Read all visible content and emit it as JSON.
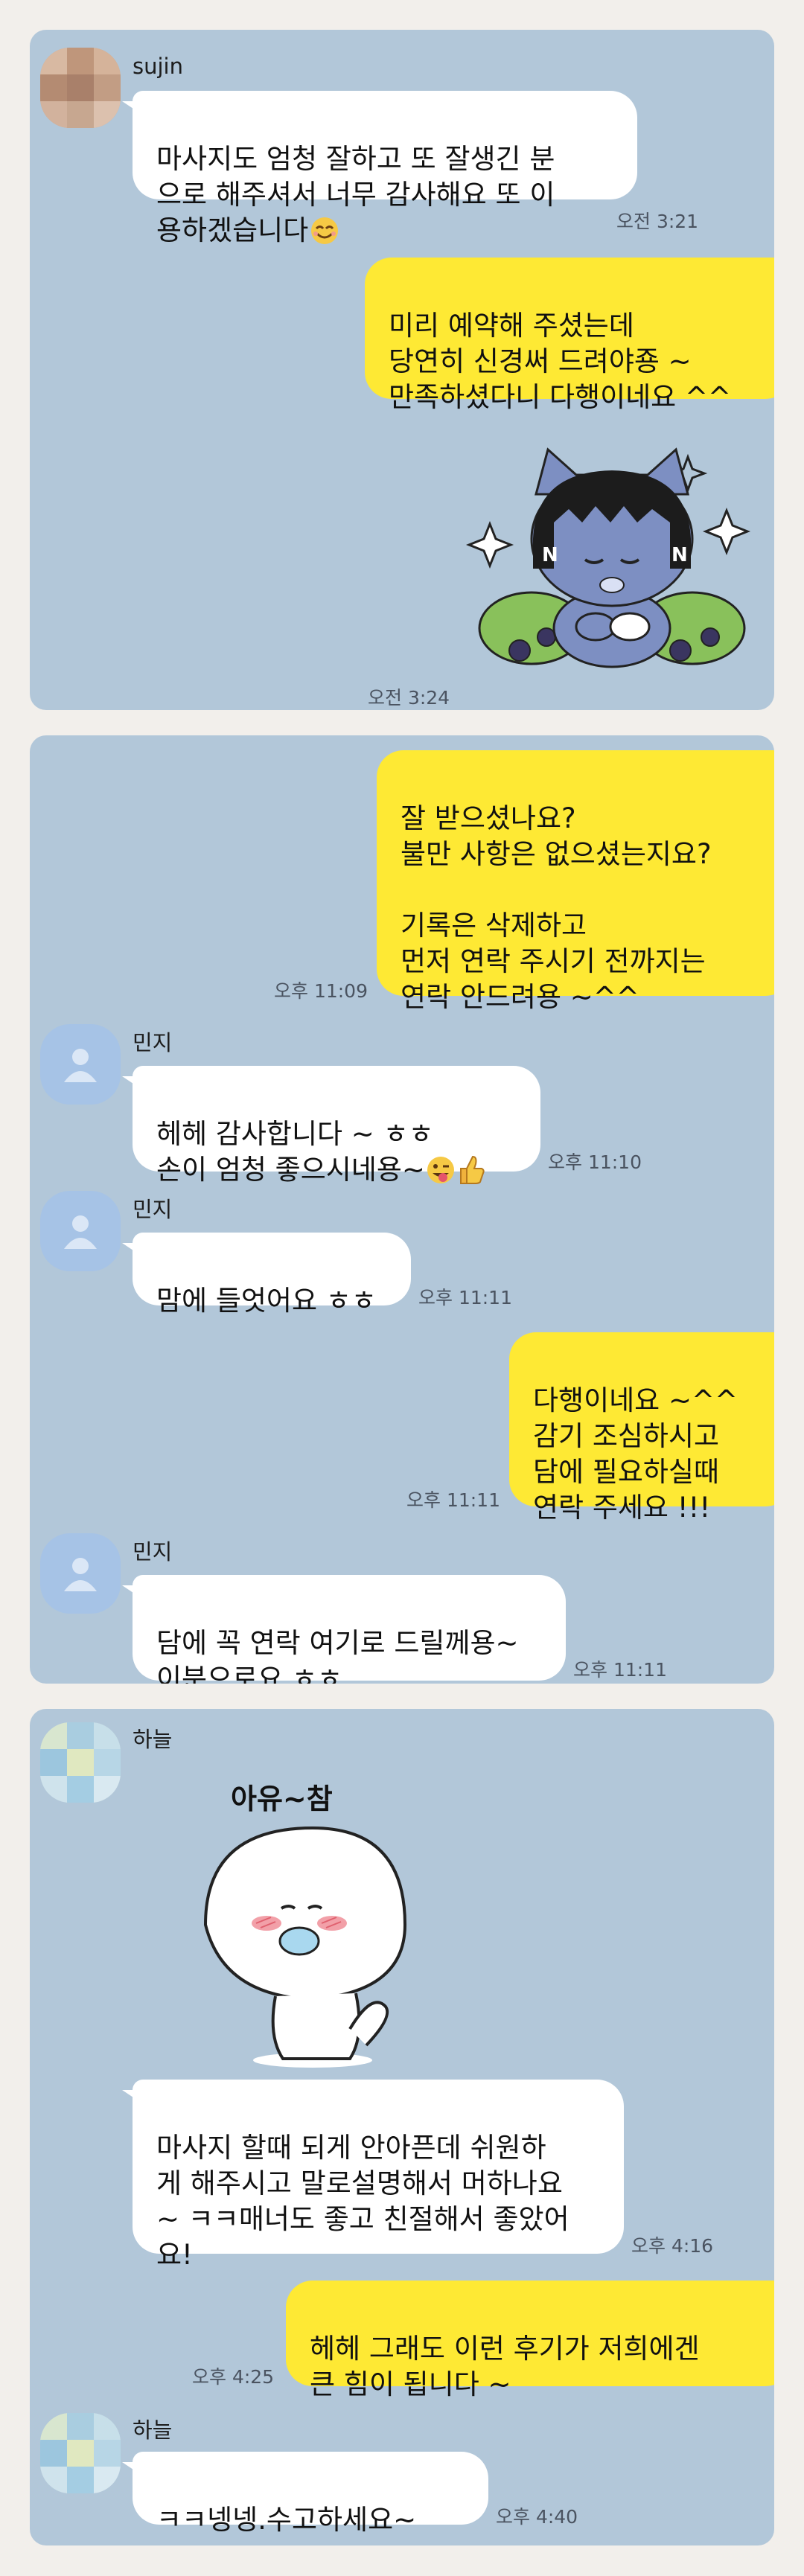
{
  "panel1": {
    "msg1": {
      "sender": "sujin",
      "text": "마사지도 엄청 잘하고 또 잘생긴 분\n으로 해주셔서 너무 감사해요 또 이\n용하겠습니다",
      "time": "오전 3:21"
    },
    "msg2": {
      "text": "미리 예약해 주셨는데\n당연히 신경써 드려야죵 ~\n만족하셨다니 다행이네요 ^^"
    },
    "sticker_time": "오전 3:24",
    "sticker_icon": "cat-character-sticker"
  },
  "panel2": {
    "msg1": {
      "text": "잘 받으셨나요?\n불만 사항은 없으셨는지요?\n\n기록은 삭제하고\n먼저 연락 주시기 전까지는\n연락 안드려용 ~^^",
      "time": "오후 11:09"
    },
    "msg2": {
      "sender": "민지",
      "text": "헤헤 감사합니다 ~ ㅎㅎ\n손이 엄청 좋으시네용~",
      "time": "오후 11:10"
    },
    "msg3": {
      "sender": "민지",
      "text": "맘에 들엇어요 ㅎㅎ",
      "time": "오후 11:11"
    },
    "msg4": {
      "text": "다행이네요 ~^^\n감기 조심하시고\n담에 필요하실때\n연락 주세요 !!!",
      "time": "오후 11:11"
    },
    "msg5": {
      "sender": "민지",
      "text": "담에 꼭 연락 여기로 드릴께용~\n이분으로요 ㅎㅎ",
      "time": "오후 11:11"
    }
  },
  "panel3": {
    "sticker": {
      "sender": "하늘",
      "caption": "아유~참",
      "icon": "blushing-character-sticker"
    },
    "msg1": {
      "text": "마사지 할때 되게 안아픈데 쉬원하\n게 해주시고 말로설명해서 머하나요\n~ ㅋㅋ매너도 좋고 친절해서 좋았어\n요!",
      "time": "오후 4:16"
    },
    "msg2": {
      "text": "헤헤 그래도 이런 후기가 저희에겐\n큰 힘이 됩니다 ~",
      "time": "오후 4:25"
    },
    "msg3": {
      "sender": "하늘",
      "text": "ㅋㅋ넹넹.수고하세요~",
      "time": "오후 4:40"
    }
  },
  "colors": {
    "background": "#b2c7d9",
    "outgoing": "#fee934",
    "incoming": "#ffffff",
    "page": "#f2efeb"
  }
}
